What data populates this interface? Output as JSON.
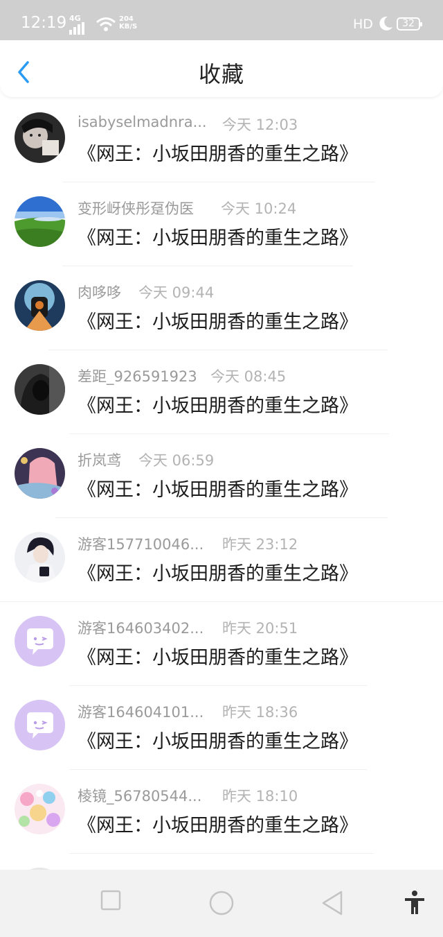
{
  "status_bar": {
    "time": "12:19",
    "network": "4G",
    "speed_value": "204",
    "speed_unit": "KB/S",
    "hd": "HD",
    "battery": "32",
    "background": "#cfcfcf"
  },
  "header": {
    "title": "收藏",
    "back_icon": "chevron-left-icon",
    "accent": "#2b9af3"
  },
  "favorites": [
    {
      "name": "isabyselmadnra...",
      "time": "今天 12:03",
      "book": "《网王：小坂田朋香的重生之路》",
      "avatar": "photo-dark-portrait"
    },
    {
      "name": "变形岈侠彤趸伪医",
      "time": "今天 10:24",
      "book": "《网王：小坂田朋香的重生之路》",
      "avatar": "photo-landscape"
    },
    {
      "name": "肉哆哆",
      "time": "今天 09:44",
      "book": "《网王：小坂田朋香的重生之路》",
      "avatar": "photo-figure-blue"
    },
    {
      "name": "差距_926591923",
      "time": "今天 08:45",
      "book": "《网王：小坂田朋香的重生之路》",
      "avatar": "photo-hood-dark"
    },
    {
      "name": "折岚鸢",
      "time": "今天 06:59",
      "book": "《网王：小坂田朋香的重生之路》",
      "avatar": "photo-anime-girl"
    },
    {
      "name": "游客157710046...",
      "time": "昨天 23:12",
      "book": "《网王：小坂田朋香的重生之路》",
      "avatar": "photo-anime-boy"
    },
    {
      "name": "游客164603402...",
      "time": "昨天 20:51",
      "book": "《网王：小坂田朋香的重生之路》",
      "avatar": "default-chat-avatar"
    },
    {
      "name": "游客164604101...",
      "time": "昨天 18:36",
      "book": "《网王：小坂田朋香的重生之路》",
      "avatar": "default-chat-avatar"
    },
    {
      "name": "棱镜_56780544...",
      "time": "昨天 18:10",
      "book": "《网王：小坂田朋香的重生之路》",
      "avatar": "photo-colorful-anime"
    }
  ],
  "nav_bar": {
    "buttons": [
      "square-recents-icon",
      "circle-home-icon",
      "triangle-back-icon",
      "accessibility-icon"
    ]
  }
}
